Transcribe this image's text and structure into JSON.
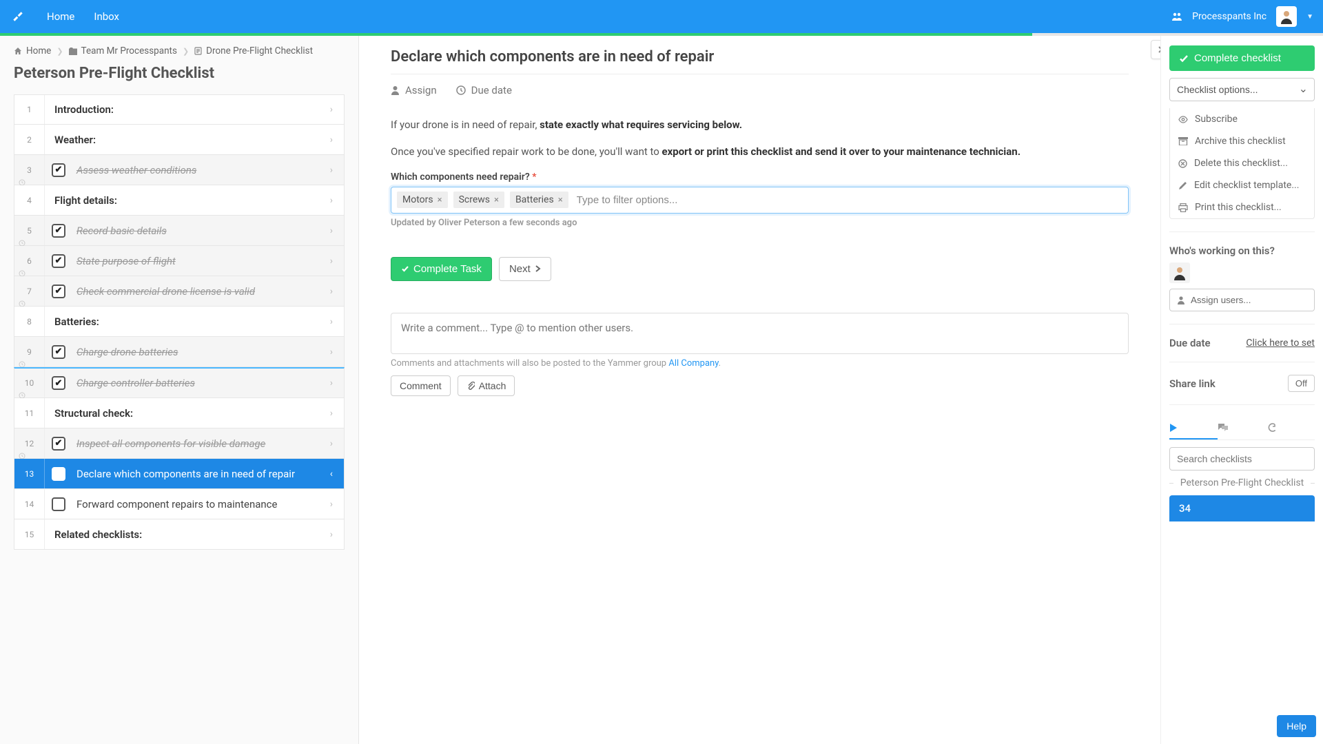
{
  "topbar": {
    "nav_home": "Home",
    "nav_inbox": "Inbox",
    "org_name": "Processpants Inc"
  },
  "breadcrumbs": {
    "home": "Home",
    "team": "Team Mr Processpants",
    "template": "Drone Pre-Flight Checklist"
  },
  "page_title": "Peterson Pre-Flight Checklist",
  "steps": [
    {
      "num": "1",
      "label": "Introduction:",
      "heading": true,
      "done": false,
      "selected": false
    },
    {
      "num": "2",
      "label": "Weather:",
      "heading": true,
      "done": false,
      "selected": false
    },
    {
      "num": "3",
      "label": "Assess weather conditions",
      "heading": false,
      "done": true,
      "selected": false
    },
    {
      "num": "4",
      "label": "Flight details:",
      "heading": true,
      "done": false,
      "selected": false
    },
    {
      "num": "5",
      "label": "Record basic details",
      "heading": false,
      "done": true,
      "selected": false
    },
    {
      "num": "6",
      "label": "State purpose of flight",
      "heading": false,
      "done": true,
      "selected": false
    },
    {
      "num": "7",
      "label": "Check commercial drone license is valid",
      "heading": false,
      "done": true,
      "selected": false
    },
    {
      "num": "8",
      "label": "Batteries:",
      "heading": true,
      "done": false,
      "selected": false
    },
    {
      "num": "9",
      "label": "Charge drone batteries",
      "heading": false,
      "done": true,
      "selected": false
    },
    {
      "num": "10",
      "label": "Charge controller batteries",
      "heading": false,
      "done": true,
      "selected": false,
      "sepline": true
    },
    {
      "num": "11",
      "label": "Structural check:",
      "heading": true,
      "done": false,
      "selected": false
    },
    {
      "num": "12",
      "label": "Inspect all components for visible damage",
      "heading": false,
      "done": true,
      "selected": false
    },
    {
      "num": "13",
      "label": "Declare which components are in need of repair",
      "heading": false,
      "done": false,
      "selected": true
    },
    {
      "num": "14",
      "label": "Forward component repairs to maintenance",
      "heading": false,
      "done": false,
      "selected": false
    },
    {
      "num": "15",
      "label": "Related checklists:",
      "heading": true,
      "done": false,
      "selected": false
    }
  ],
  "task": {
    "title": "Declare which components are in need of repair",
    "assign": "Assign",
    "due": "Due date",
    "body_intro": "If your drone is in need of repair, ",
    "body_intro_strong": "state exactly what requires servicing below.",
    "body2_pre": "Once you've specified repair work to be done, you'll want to ",
    "body2_strong": "export or print this checklist and send it over to your maintenance technician.",
    "field_label": "Which components need repair?",
    "tags": [
      "Motors",
      "Screws",
      "Batteries"
    ],
    "tag_placeholder": "Type to filter options...",
    "updated": "Updated by Oliver Peterson a few seconds ago",
    "complete_btn": "Complete Task",
    "next_btn": "Next",
    "comment_placeholder": "Write a comment... Type @ to mention other users.",
    "comment_note_pre": "Comments and attachments will also be posted to the Yammer group ",
    "comment_note_link": "All Company",
    "comment_btn": "Comment",
    "attach_btn": "Attach"
  },
  "right": {
    "complete_checklist": "Complete checklist",
    "options_label": "Checklist options...",
    "menu": {
      "subscribe": "Subscribe",
      "archive": "Archive this checklist",
      "delete": "Delete this checklist...",
      "edit": "Edit checklist template...",
      "print": "Print this checklist..."
    },
    "whos_working": "Who's working on this?",
    "assign_users": "Assign users...",
    "due_date_label": "Due date",
    "due_date_set": "Click here to set",
    "share_link": "Share link",
    "share_toggle": "Off",
    "search_placeholder": "Search checklists",
    "bc_label": "Peterson Pre-Flight Checklist",
    "card_count": "34",
    "help": "Help"
  }
}
